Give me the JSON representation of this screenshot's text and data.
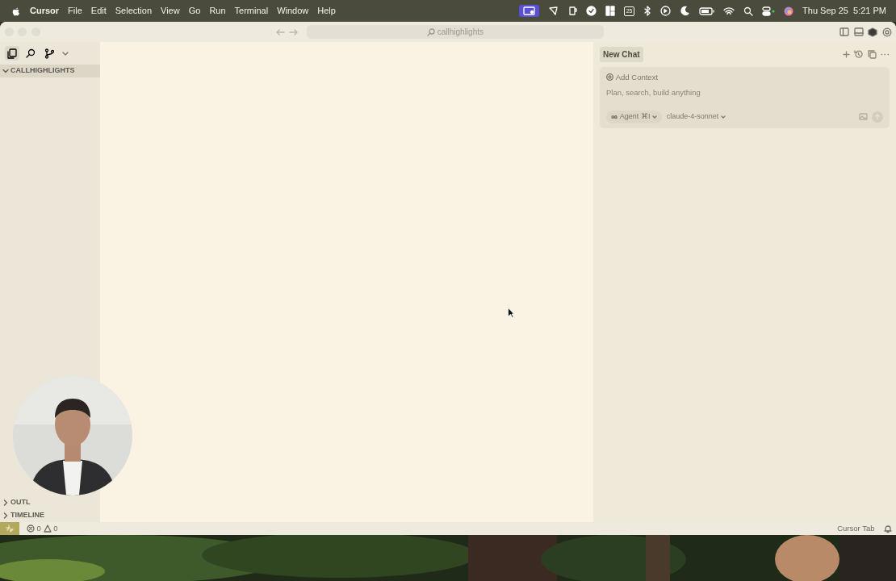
{
  "menu_bar": {
    "app": "Cursor",
    "menus": [
      "File",
      "Edit",
      "Selection",
      "View",
      "Go",
      "Run",
      "Terminal",
      "Window",
      "Help"
    ],
    "calendar_day": "25",
    "clock": "Thu Sep 25  5:21 PM"
  },
  "title_bar": {
    "search": "callhighlights"
  },
  "sidebar": {
    "tabs": [
      {
        "kind": "files",
        "selected": true
      },
      {
        "kind": "search",
        "selected": false
      },
      {
        "kind": "branch",
        "selected": false
      }
    ],
    "folder": {
      "label": "CALLHIGHLIGHTS",
      "expanded": true
    },
    "sections": [
      {
        "label": "OUTL",
        "expanded": false
      },
      {
        "label": "TIMELINE",
        "expanded": false
      }
    ]
  },
  "chat": {
    "tab": "New Chat",
    "add_context": "Add Context",
    "placeholder": "Plan, search, build anything",
    "agent": "Agent",
    "agent_shortcut": "⌘I",
    "model": "claude-4-sonnet"
  },
  "status_bar": {
    "errors": "0",
    "warnings": "0",
    "right_label": "Cursor Tab"
  }
}
